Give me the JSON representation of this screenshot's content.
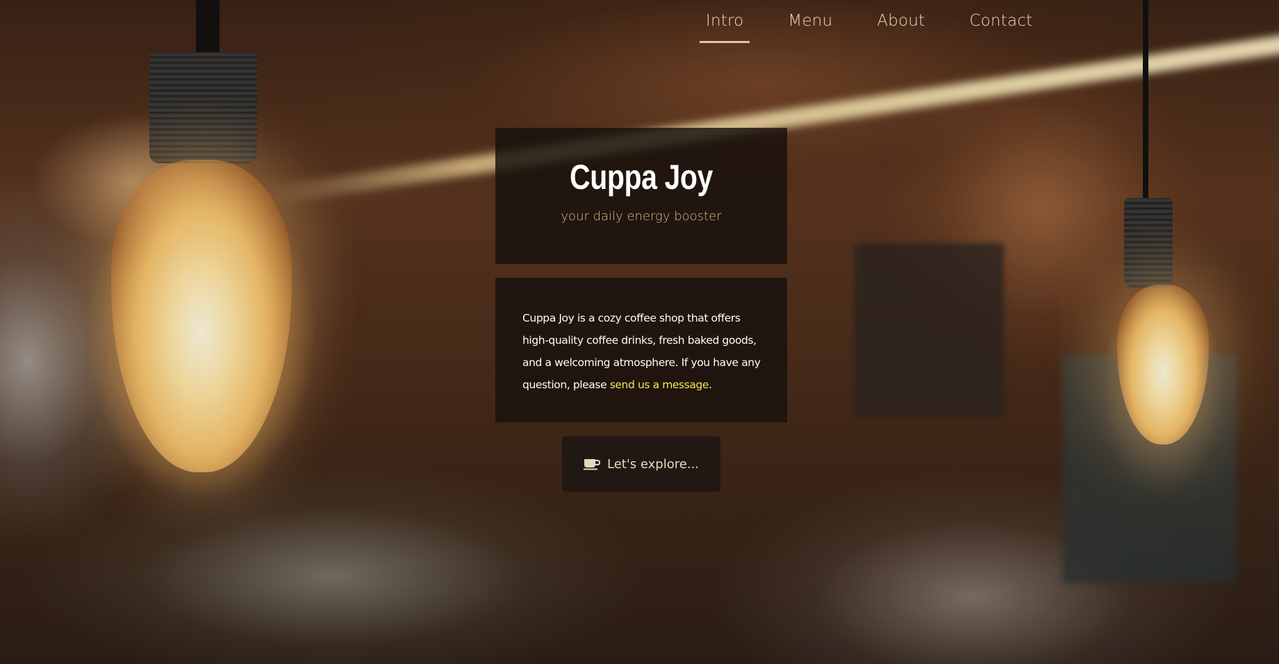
{
  "nav": {
    "items": [
      {
        "label": "Intro",
        "active": true
      },
      {
        "label": "Menu",
        "active": false
      },
      {
        "label": "About",
        "active": false
      },
      {
        "label": "Contact",
        "active": false
      }
    ],
    "active_underline_color": "#e9c49a"
  },
  "hero": {
    "title": "Cuppa Joy",
    "tagline": "your daily energy booster"
  },
  "intro": {
    "text_before_link": "Cuppa Joy is a cozy coffee shop that offers high-quality coffee drinks, fresh baked goods, and a welcoming atmosphere. If you have any question, please ",
    "link_text": "send us a message",
    "text_after_link": ".",
    "link_color": "#f4e85a"
  },
  "explore_button": {
    "label": "Let's explore...",
    "icon": "coffee-cup-icon"
  }
}
